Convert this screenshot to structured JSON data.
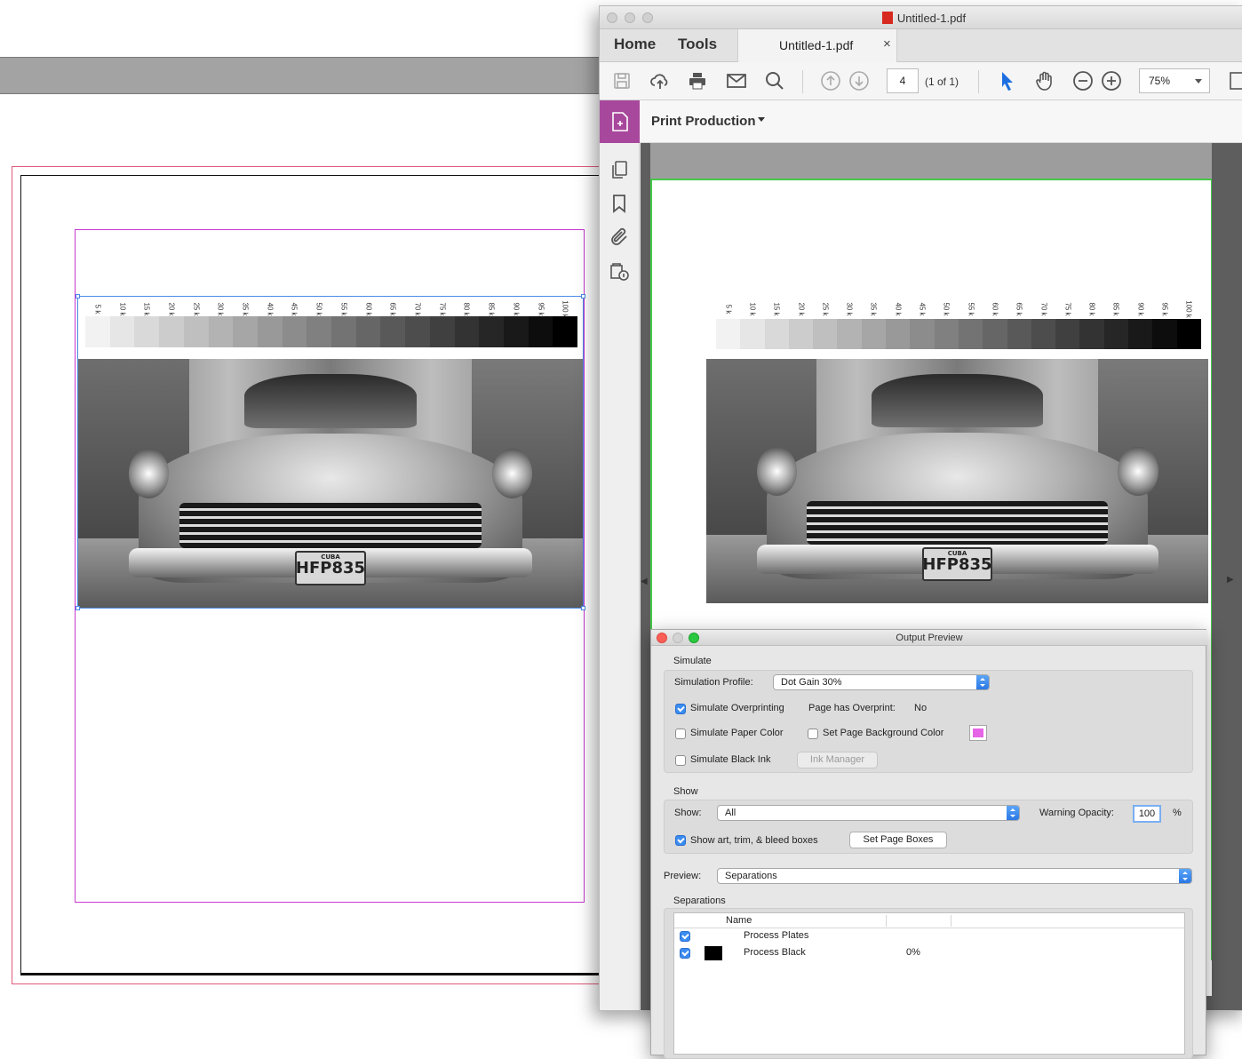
{
  "colors": {
    "magenta_accent": "#a8489c",
    "page_bg_swatch": "#e664e6",
    "checkbox_blue": "#3b8cf0",
    "bleed_red": "#e05a7a",
    "margin_purple": "#c838d0",
    "green_box": "#46c94a"
  },
  "wedge": {
    "labels": [
      "5 k",
      "10 k",
      "15 k",
      "20 k",
      "25 k",
      "30 k",
      "35 k",
      "40 k",
      "45 k",
      "50 k",
      "55 k",
      "60 k",
      "65 k",
      "70 k",
      "75 k",
      "80 k",
      "85 k",
      "90 k",
      "95 k",
      "100 k"
    ],
    "percents": [
      5,
      10,
      15,
      20,
      25,
      30,
      35,
      40,
      45,
      50,
      55,
      60,
      65,
      70,
      75,
      80,
      85,
      90,
      95,
      100
    ]
  },
  "photo": {
    "plate_country": "CUBA",
    "plate_number": "HFP835"
  },
  "acrobat": {
    "window_title": "Untitled-1.pdf",
    "nav": {
      "home": "Home",
      "tools": "Tools"
    },
    "doc_tab": {
      "label": "Untitled-1.pdf",
      "close": "×"
    },
    "toolbar": {
      "page_value": "4",
      "page_of": "(1 of 1)",
      "zoom": "75%",
      "icons": [
        "save-icon",
        "upload-icon",
        "print-icon",
        "mail-icon",
        "search-icon",
        "page-up-icon",
        "page-down-icon",
        "select-arrow-icon",
        "hand-icon",
        "zoom-out-icon",
        "zoom-in-icon"
      ]
    },
    "print_production": "Print Production",
    "left_nav_icons": [
      "pages-icon",
      "bookmark-icon",
      "attachment-icon",
      "security-icon"
    ]
  },
  "output_preview": {
    "title": "Output Preview",
    "simulate": {
      "group_label": "Simulate",
      "profile_label": "Simulation Profile:",
      "profile_value": "Dot Gain 30%",
      "overprinting_label": "Simulate Overprinting",
      "overprinting_checked": true,
      "has_overprint_label": "Page has Overprint:",
      "has_overprint_value": "No",
      "paper_color_label": "Simulate Paper Color",
      "paper_color_checked": false,
      "bg_color_label": "Set Page Background Color",
      "bg_color_checked": false,
      "black_ink_label": "Simulate Black Ink",
      "black_ink_checked": false,
      "ink_manager_label": "Ink Manager"
    },
    "show": {
      "group_label": "Show",
      "show_label": "Show:",
      "show_value": "All",
      "warning_opacity_label": "Warning Opacity:",
      "warning_opacity_value": "100",
      "percent_sign": "%",
      "boxes_label": "Show art, trim, & bleed boxes",
      "boxes_checked": true,
      "set_page_boxes_label": "Set Page Boxes"
    },
    "preview_label": "Preview:",
    "preview_value": "Separations",
    "separations": {
      "group_label": "Separations",
      "col_name": "Name",
      "rows": [
        {
          "name": "Process Plates",
          "checked": true,
          "swatch": "",
          "value": ""
        },
        {
          "name": "Process Black",
          "checked": true,
          "swatch": "#000000",
          "value": "0%"
        }
      ]
    }
  }
}
